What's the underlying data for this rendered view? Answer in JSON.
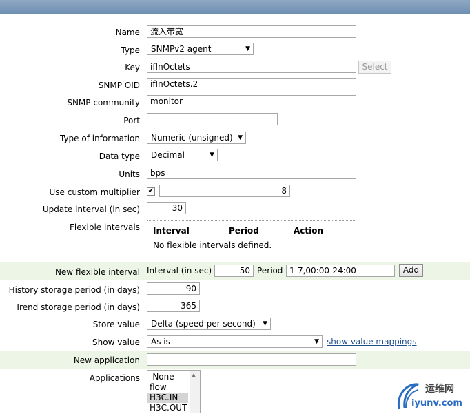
{
  "form": {
    "name": {
      "label": "Name",
      "value": "流入带宽"
    },
    "type": {
      "label": "Type",
      "value": "SNMPv2 agent"
    },
    "key": {
      "label": "Key",
      "value": "ifInOctets",
      "select_label": "Select"
    },
    "snmp_oid": {
      "label": "SNMP OID",
      "value": "ifInOctets.2"
    },
    "snmp_community": {
      "label": "SNMP community",
      "value": "monitor"
    },
    "port": {
      "label": "Port",
      "value": ""
    },
    "type_of_information": {
      "label": "Type of information",
      "value": "Numeric (unsigned)"
    },
    "data_type": {
      "label": "Data type",
      "value": "Decimal"
    },
    "units": {
      "label": "Units",
      "value": "bps"
    },
    "custom_multiplier": {
      "label": "Use custom multiplier",
      "checked": true,
      "value": "8"
    },
    "update_interval": {
      "label": "Update interval (in sec)",
      "value": "30"
    },
    "flexible_intervals": {
      "label": "Flexible intervals",
      "columns": [
        "Interval",
        "Period",
        "Action"
      ],
      "empty_text": "No flexible intervals defined."
    },
    "new_flexible_interval": {
      "label": "New flexible interval",
      "interval_label": "Interval (in sec)",
      "interval_value": "50",
      "period_label": "Period",
      "period_value": "1-7,00:00-24:00",
      "add_label": "Add"
    },
    "history": {
      "label": "History storage period (in days)",
      "value": "90"
    },
    "trend": {
      "label": "Trend storage period (in days)",
      "value": "365"
    },
    "store_value": {
      "label": "Store value",
      "value": "Delta (speed per second)"
    },
    "show_value": {
      "label": "Show value",
      "value": "As is",
      "mappings_link": "show value mappings"
    },
    "new_application": {
      "label": "New application",
      "value": ""
    },
    "applications": {
      "label": "Applications",
      "options": [
        "-None-",
        "flow",
        "H3C.IN",
        "H3C.OUT"
      ],
      "selected_index": 2
    }
  },
  "watermark": {
    "title": "运维网",
    "domain": "iyunv.com"
  },
  "colors": {
    "alt_row": "#edf5e6",
    "link": "#20508a",
    "topbar": "#7796b8",
    "logo": "#2a6cc4"
  }
}
